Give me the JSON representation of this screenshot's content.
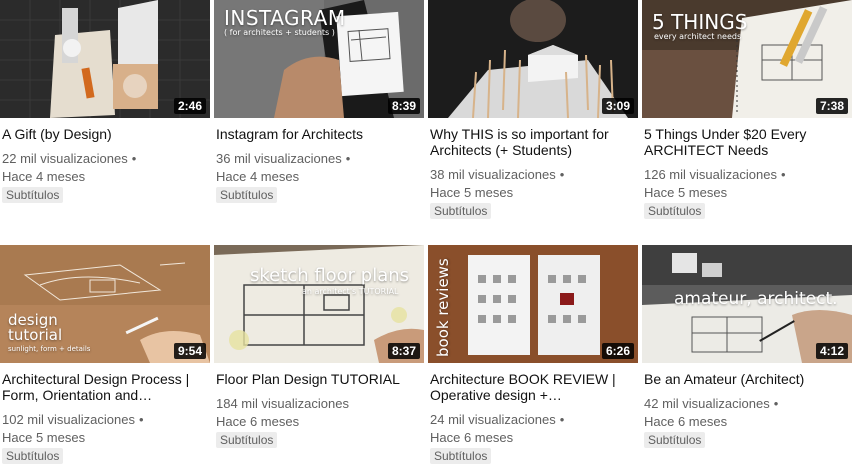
{
  "videos": [
    {
      "title": "A Gift (by Design)",
      "views": "22 mil visualizaciones",
      "age": "Hace 4 meses",
      "badge": "Subtítulos",
      "duration": "2:46",
      "overlay_main": "",
      "overlay_sub": ""
    },
    {
      "title": "Instagram for Architects",
      "views": "36 mil visualizaciones",
      "age": "Hace 4 meses",
      "badge": "Subtítulos",
      "duration": "8:39",
      "overlay_main": "INSTAGRAM",
      "overlay_sub": "( for architects + students )"
    },
    {
      "title": "Why THIS is so important for Architects (+ Students)",
      "views": "38 mil visualizaciones",
      "age": "Hace 5 meses",
      "badge": "Subtítulos",
      "duration": "3:09",
      "overlay_main": "",
      "overlay_sub": ""
    },
    {
      "title": "5 Things Under $20 Every ARCHITECT Needs",
      "views": "126 mil visualizaciones",
      "age": "Hace 5 meses",
      "badge": "Subtítulos",
      "duration": "7:38",
      "overlay_main": "5 THINGS",
      "overlay_sub": "every architect needs"
    },
    {
      "title": "Architectural Design Process | Form, Orientation and…",
      "views": "102 mil visualizaciones",
      "age": "Hace 5 meses",
      "badge": "Subtítulos",
      "duration": "9:54",
      "overlay_main": "design tutorial",
      "overlay_sub": "sunlight, form + details"
    },
    {
      "title": "Floor Plan Design TUTORIAL",
      "views": "184 mil visualizaciones",
      "age": "Hace 6 meses",
      "badge": "Subtítulos",
      "duration": "8:37",
      "overlay_main": "sketch floor plans",
      "overlay_sub": "an architect's TUTORIAL"
    },
    {
      "title": "Architecture BOOK REVIEW | Operative design +…",
      "views": "24 mil visualizaciones",
      "age": "Hace 6 meses",
      "badge": "Subtítulos",
      "duration": "6:26",
      "overlay_main": "book reviews",
      "overlay_sub": ""
    },
    {
      "title": "Be an Amateur (Architect)",
      "views": "42 mil visualizaciones",
      "age": "Hace 6 meses",
      "badge": "Subtítulos",
      "duration": "4:12",
      "overlay_main": "amateur, architect.",
      "overlay_sub": ""
    }
  ],
  "dot": "•",
  "icons": [
    "video-thumbnail"
  ]
}
